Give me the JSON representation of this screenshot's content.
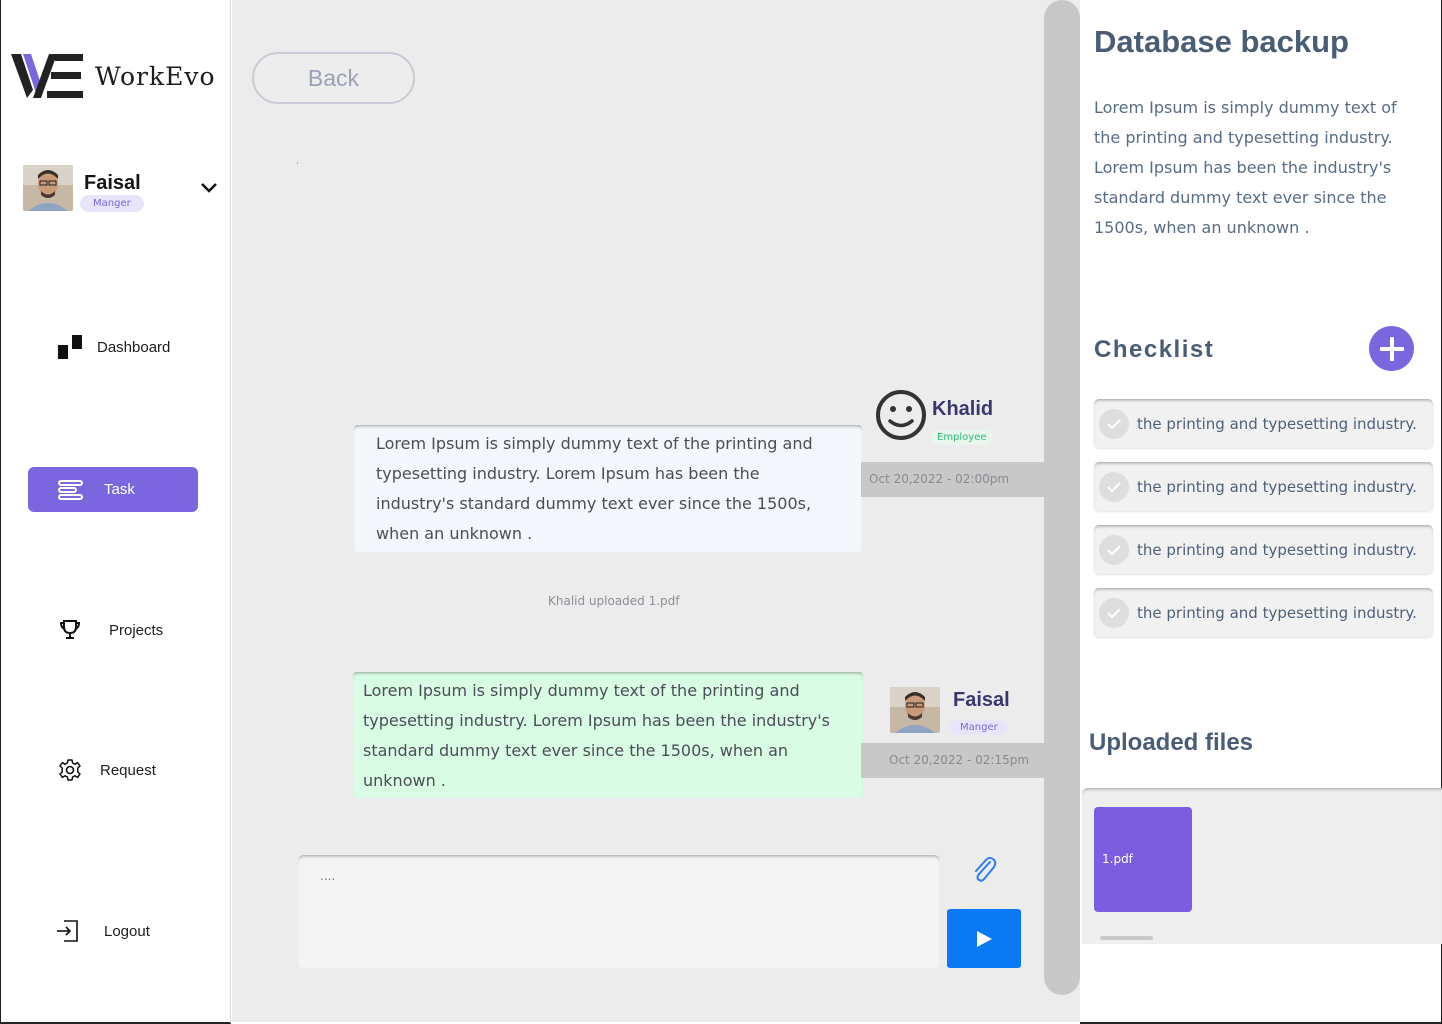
{
  "brand": {
    "name": "WorkEvo",
    "accent": "#7b66e0"
  },
  "user": {
    "name": "Faisal",
    "role": "Manger"
  },
  "nav": [
    {
      "label": "Dashboard",
      "icon": "dashboard-icon"
    },
    {
      "label": "Task",
      "icon": "task-list-icon",
      "active": true
    },
    {
      "label": "Projects",
      "icon": "trophy-icon"
    },
    {
      "label": "Request",
      "icon": "gear-icon"
    },
    {
      "label": "Logout",
      "icon": "logout-icon"
    }
  ],
  "back_label": "Back",
  "messages": [
    {
      "sender": "Khalid",
      "role": "Employee",
      "text": "Lorem Ipsum is simply dummy text of the printing and typesetting industry. Lorem Ipsum has been the industry's standard dummy text ever since the 1500s, when an unknown .",
      "time": "Oct 20,2022 - 02:00pm"
    },
    {
      "sender": "Faisal",
      "role": "Manger",
      "text": "Lorem Ipsum is simply dummy text of the printing and typesetting industry. Lorem Ipsum has been the industry's standard dummy text ever since the 1500s, when an unknown .",
      "time": "Oct 20,2022 - 02:15pm"
    }
  ],
  "upload_note": "Khalid uploaded 1.pdf",
  "composer": {
    "placeholder": "...."
  },
  "panel": {
    "title": "Database backup",
    "description": "Lorem Ipsum is simply dummy text of the printing and typesetting industry. Lorem Ipsum has been the industry's standard dummy text ever since the 1500s, when an unknown .",
    "checklist_title": "Checklist",
    "checklist": [
      "the printing and typesetting industry.",
      "the printing and typesetting industry.",
      "the printing and typesetting industry.",
      "the printing and typesetting industry."
    ],
    "files_title": "Uploaded files",
    "files": [
      "1.pdf"
    ]
  }
}
